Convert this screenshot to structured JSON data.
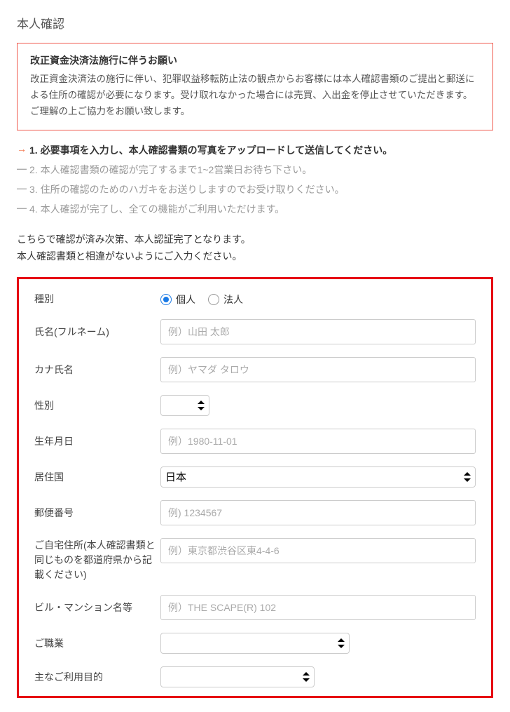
{
  "page_title": "本人確認",
  "notice": {
    "title": "改正資金決済法施行に伴うお願い",
    "body": "改正資金決済法の施行に伴い、犯罪収益移転防止法の観点からお客様には本人確認書類のご提出と郵送による住所の確認が必要になります。受け取れなかった場合には売買、入出金を停止させていただきます。ご理解の上ご協力をお願い致します。"
  },
  "steps": [
    {
      "text": "1. 必要事項を入力し、本人確認書類の写真をアップロードして送信してください。",
      "active": true
    },
    {
      "text": "2. 本人確認書類の確認が完了するまで1~2営業日お待ち下さい。",
      "active": false
    },
    {
      "text": "3. 住所の確認のためのハガキをお送りしますのでお受け取りください。",
      "active": false
    },
    {
      "text": "4. 本人確認が完了し、全ての機能がご利用いただけます。",
      "active": false
    }
  ],
  "instructions": {
    "line1": "こちらで確認が済み次第、本人認証完了となります。",
    "line2": "本人確認書類と相違がないようにご入力ください。"
  },
  "form": {
    "type": {
      "label": "種別",
      "options": {
        "individual": "個人",
        "corporate": "法人"
      },
      "selected": "individual"
    },
    "fullname": {
      "label": "氏名(フルネーム)",
      "placeholder": "例）山田 太郎"
    },
    "kana": {
      "label": "カナ氏名",
      "placeholder": "例）ヤマダ タロウ"
    },
    "gender": {
      "label": "性別"
    },
    "birthday": {
      "label": "生年月日",
      "placeholder": "例）1980-11-01"
    },
    "country": {
      "label": "居住国",
      "value": "日本"
    },
    "postal": {
      "label": "郵便番号",
      "placeholder": "例) 1234567"
    },
    "address": {
      "label": "ご自宅住所(本人確認書類と同じものを都道府県から記載ください)",
      "placeholder": "例）東京都渋谷区東4-4-6"
    },
    "building": {
      "label": "ビル・マンション名等",
      "placeholder": "例）THE SCAPE(R) 102"
    },
    "occupation": {
      "label": "ご職業"
    },
    "purpose": {
      "label": "主なご利用目的"
    }
  }
}
